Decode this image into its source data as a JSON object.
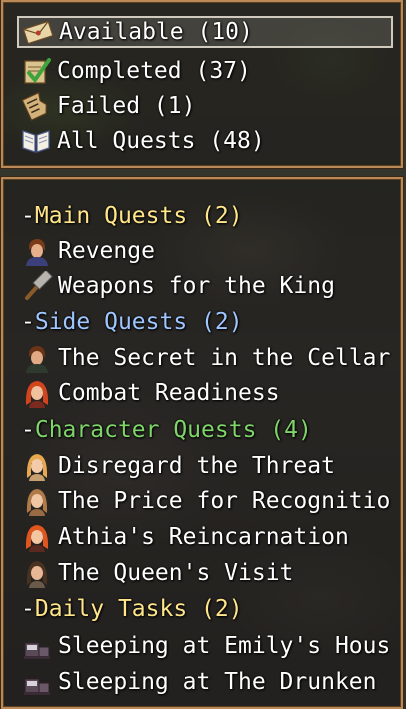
{
  "filters": [
    {
      "label": "Available (10)",
      "icon": "envelope-icon",
      "selected": true
    },
    {
      "label": "Completed (37)",
      "icon": "checkmark-scroll-icon",
      "selected": false
    },
    {
      "label": "Failed (1)",
      "icon": "torn-scroll-icon",
      "selected": false
    },
    {
      "label": "All Quests (48)",
      "icon": "open-book-icon",
      "selected": false
    }
  ],
  "categories": [
    {
      "prefix": "-",
      "label": "Main Quests (2)",
      "color": "#ffe68a",
      "quests": [
        {
          "title": "Revenge",
          "icon": "brown-hair-portrait-icon"
        },
        {
          "title": "Weapons for the King",
          "icon": "hammer-icon"
        }
      ]
    },
    {
      "prefix": "-",
      "label": "Side Quests (2)",
      "color": "#9fc6ff",
      "quests": [
        {
          "title": "The Secret in the Cellar",
          "icon": "brown-hair-portrait-icon"
        },
        {
          "title": "Combat Readiness",
          "icon": "red-hair-portrait-icon"
        }
      ]
    },
    {
      "prefix": "-",
      "label": "Character Quests (4)",
      "color": "#7fd46a",
      "quests": [
        {
          "title": "Disregard the Threat",
          "icon": "blonde-portrait-icon"
        },
        {
          "title": "The Price for Recognitio",
          "icon": "light-brown-portrait-icon"
        },
        {
          "title": "Athia's Reincarnation",
          "icon": "red-hair-portrait-icon"
        },
        {
          "title": "The Queen's Visit",
          "icon": "dark-hair-portrait-icon"
        }
      ]
    },
    {
      "prefix": "-",
      "label": "Daily Tasks (2)",
      "color": "#ffe68a",
      "quests": [
        {
          "title": "Sleeping at Emily's Hous",
          "icon": "bed-icon"
        },
        {
          "title": "Sleeping at The Drunken",
          "icon": "bed-icon"
        }
      ]
    }
  ]
}
